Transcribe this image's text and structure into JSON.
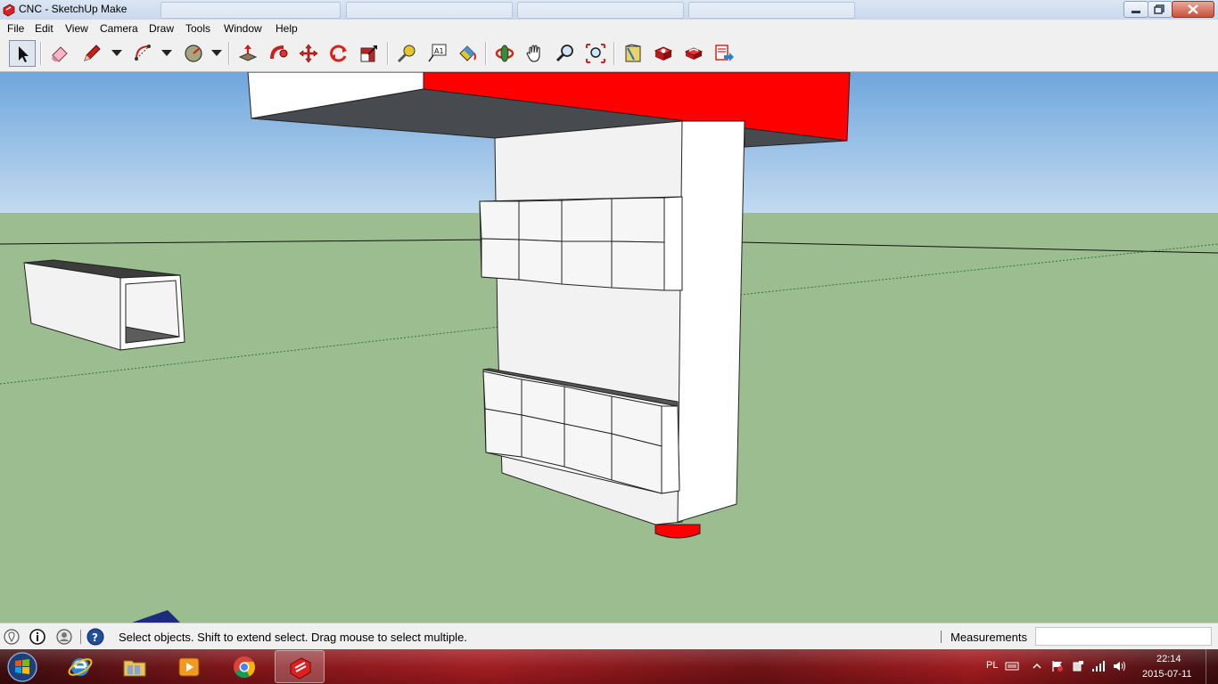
{
  "window": {
    "title": "CNC - SketchUp Make"
  },
  "menu": [
    "File",
    "Edit",
    "View",
    "Camera",
    "Draw",
    "Tools",
    "Window",
    "Help"
  ],
  "toolbar": {
    "tools": [
      "select",
      "eraser",
      "pencil",
      "arc",
      "circle",
      "push-pull",
      "follow-me",
      "move",
      "rotate",
      "scale",
      "tape-measure",
      "text",
      "paint-bucket",
      "orbit",
      "pan",
      "zoom",
      "zoom-extents",
      "warehouse",
      "components",
      "extension-warehouse",
      "share-model"
    ]
  },
  "status": {
    "message": "Select objects. Shift to extend select. Drag mouse to select multiple.",
    "measurements_label": "Measurements",
    "measurements_value": ""
  },
  "taskbar": {
    "apps": [
      "internet-explorer",
      "windows-explorer",
      "media-player",
      "chrome",
      "sketchup"
    ],
    "active_app": "sketchup",
    "language": "PL",
    "time": "22:14",
    "date": "2015-07-11"
  },
  "colors": {
    "sky_top": "#6fa6dc",
    "sky_bottom": "#c3dbf0",
    "ground": "#9bbd8f",
    "red_part": "#ff0000",
    "shadow_face": "#474b4f"
  }
}
